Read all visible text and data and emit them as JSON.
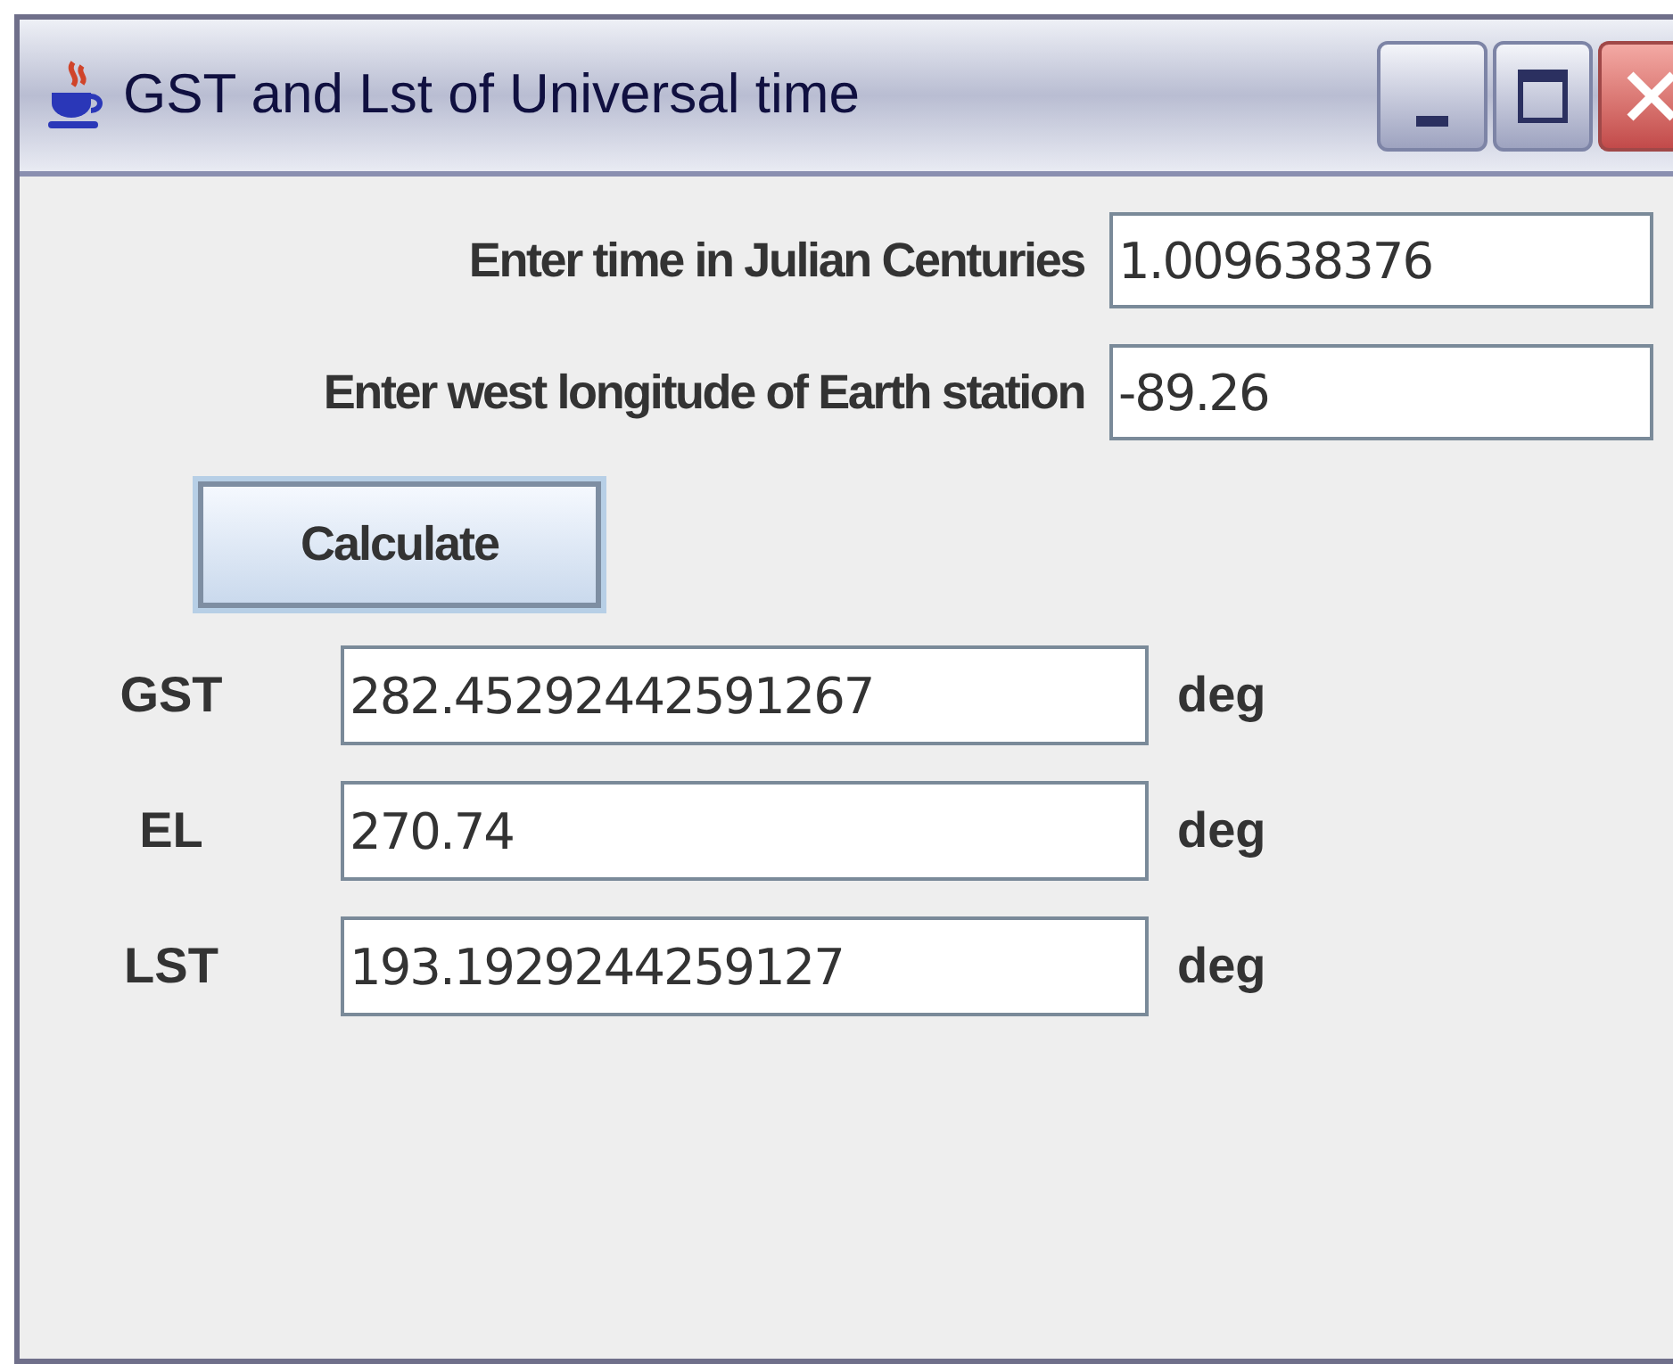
{
  "window": {
    "title": "GST and Lst of Universal time"
  },
  "inputs": [
    {
      "label": "Enter time in Julian Centuries",
      "value": "1.009638376"
    },
    {
      "label": "Enter west longitude of Earth station",
      "value": "-89.26"
    }
  ],
  "button": {
    "label": "Calculate"
  },
  "results": [
    {
      "label": "GST",
      "value": "282.45292442591267",
      "unit": "deg"
    },
    {
      "label": "EL",
      "value": "270.74",
      "unit": "deg"
    },
    {
      "label": "LST",
      "value": "193.1929244259127",
      "unit": "deg"
    }
  ]
}
